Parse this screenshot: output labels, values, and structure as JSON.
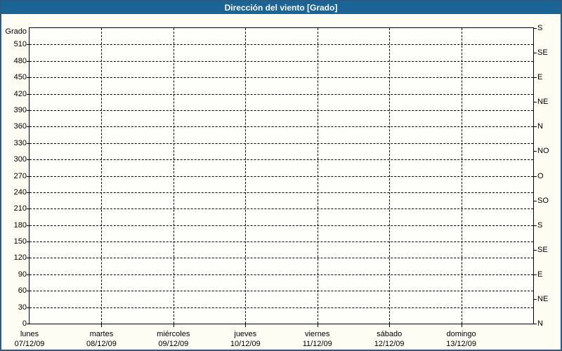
{
  "title": "Dirección del viento [Grado]",
  "colors": {
    "titlebar_bg": "#1B6496",
    "title_text": "#FFFFFF",
    "frame_border": "#2B5A82",
    "content_bg": "#FDFDF4",
    "plot_bg": "#FEFEFB",
    "grid": "#000000"
  },
  "chart_data": {
    "type": "line",
    "title": "Dirección del viento [Grado]",
    "grid": "dashed",
    "legend": "none",
    "series": [],
    "y_axis_left": {
      "label": "Grado",
      "min": 0,
      "max": 540,
      "tick_step": 30,
      "tick_values": [
        0,
        30,
        60,
        90,
        120,
        150,
        180,
        210,
        240,
        270,
        300,
        330,
        360,
        390,
        420,
        450,
        480,
        510
      ],
      "tick_labels": [
        "0",
        "30",
        "60",
        "90",
        "120",
        "150",
        "180",
        "210",
        "240",
        "270",
        "300",
        "330",
        "360",
        "390",
        "420",
        "450",
        "480",
        "510"
      ]
    },
    "y_axis_right": {
      "tick_step": 45,
      "tick_values": [
        0,
        45,
        90,
        135,
        180,
        225,
        270,
        315,
        360,
        405,
        450,
        495,
        540
      ],
      "tick_labels": [
        "N",
        "NE",
        "E",
        "SE",
        "S",
        "SO",
        "O",
        "NO",
        "N",
        "NE",
        "E",
        "SE",
        "S"
      ]
    },
    "x_axis": {
      "days": [
        {
          "name": "lunes",
          "date": "07/12/09"
        },
        {
          "name": "martes",
          "date": "08/12/09"
        },
        {
          "name": "miércoles",
          "date": "09/12/09"
        },
        {
          "name": "jueves",
          "date": "10/12/09"
        },
        {
          "name": "viernes",
          "date": "11/12/09"
        },
        {
          "name": "sábado",
          "date": "12/12/09"
        },
        {
          "name": "domingo",
          "date": "13/12/09"
        }
      ]
    }
  }
}
